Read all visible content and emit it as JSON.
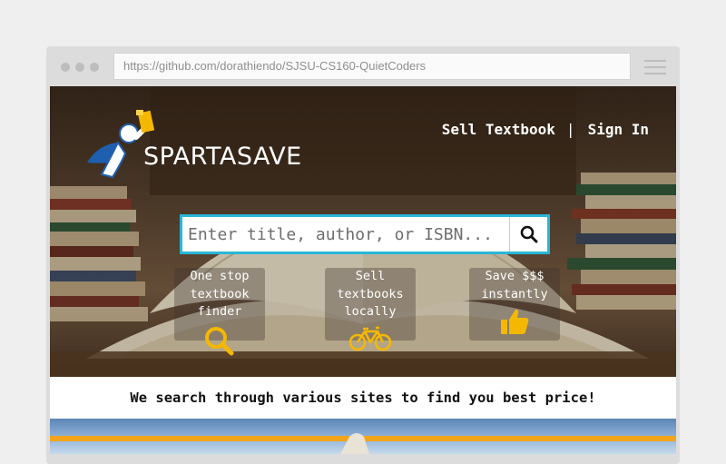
{
  "browser": {
    "url": "https://github.com/dorathiendo/SJSU-CS160-QuietCoders"
  },
  "brand": {
    "name": "SPARTASAVE",
    "accent_color": "#f5b800",
    "search_border_color": "#29b6d8"
  },
  "nav": {
    "sell_label": "Sell Textbook",
    "separator": "|",
    "signin_label": "Sign In"
  },
  "search": {
    "placeholder": "Enter title, author, or ISBN...",
    "button_icon": "search-icon"
  },
  "features": [
    {
      "lines": [
        "One stop",
        "textbook",
        "finder"
      ],
      "icon": "magnifier-icon"
    },
    {
      "lines": [
        "Sell",
        "textbooks",
        "locally"
      ],
      "icon": "bicycle-icon"
    },
    {
      "lines": [
        "Save $$$",
        "instantly"
      ],
      "icon": "thumbs-up-icon"
    }
  ],
  "tagline": "We search through various sites to find you best price!"
}
